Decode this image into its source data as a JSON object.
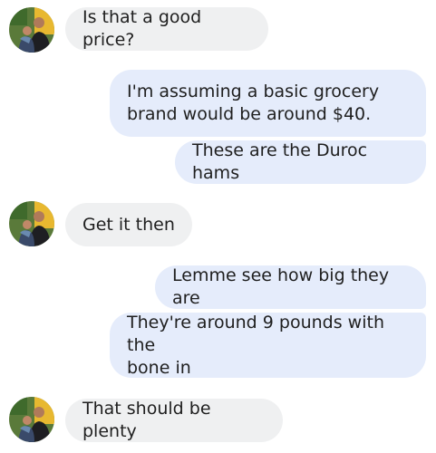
{
  "conversation": {
    "contact_avatar_icon": "person-with-child-photo-icon",
    "colors": {
      "incoming_bubble": "#eff0f1",
      "outgoing_bubble": "#e5ecfb",
      "text": "#1f1f1f"
    },
    "messages": [
      {
        "sender": "contact",
        "text": "Is that a good price?"
      },
      {
        "sender": "me",
        "text": "I'm assuming a basic grocery\nbrand would be around $40."
      },
      {
        "sender": "me",
        "text": "These are the Duroc hams"
      },
      {
        "sender": "contact",
        "text": "Get it then"
      },
      {
        "sender": "me",
        "text": "Lemme see how big they are"
      },
      {
        "sender": "me",
        "text": "They're around 9 pounds with the\nbone in"
      },
      {
        "sender": "contact",
        "text": "That should be plenty"
      }
    ]
  }
}
